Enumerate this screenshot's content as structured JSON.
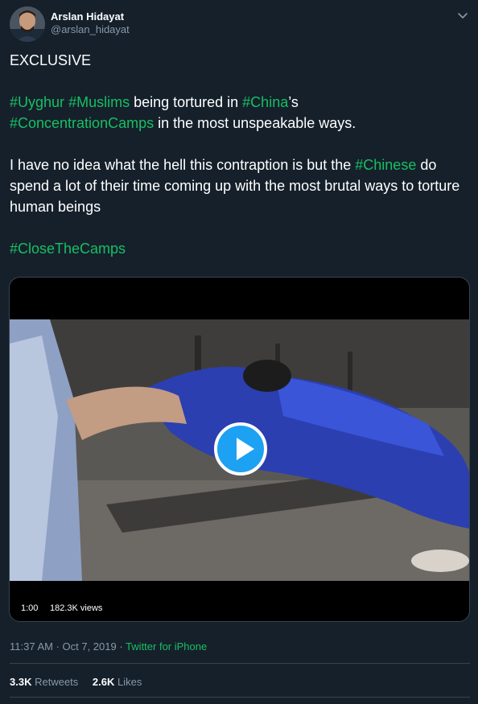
{
  "user": {
    "name": "Arslan Hidayat",
    "handle": "@arslan_hidayat"
  },
  "tweet": {
    "line1": "EXCLUSIVE",
    "p2": {
      "tag1": "#Uyghur",
      "tag2": "#Muslims",
      "text1": " being tortured in ",
      "tag3": "#China",
      "text2": "’s"
    },
    "p3": {
      "tag4": "#ConcentrationCamps",
      "text3": " in the most unspeakable ways."
    },
    "p4": {
      "text4": "I have no idea what the hell this contraption is but the ",
      "tag5": "#Chinese",
      "text5": " do spend a lot of their time coming up with the most brutal ways to torture human beings"
    },
    "p5": {
      "tag6": "#CloseTheCamps"
    }
  },
  "video": {
    "duration": "1:00",
    "views": "182.3K views"
  },
  "meta": {
    "timestamp": "11:37 AM · Oct 7, 2019",
    "separator": " · ",
    "source": "Twitter for iPhone"
  },
  "stats": {
    "retweets_count": "3.3K",
    "retweets_label": "Retweets",
    "likes_count": "2.6K",
    "likes_label": "Likes"
  },
  "colors": {
    "background": "#15202b",
    "hashtag": "#17bf63",
    "secondary_text": "#8899a6",
    "play_button": "#1da1f2"
  }
}
